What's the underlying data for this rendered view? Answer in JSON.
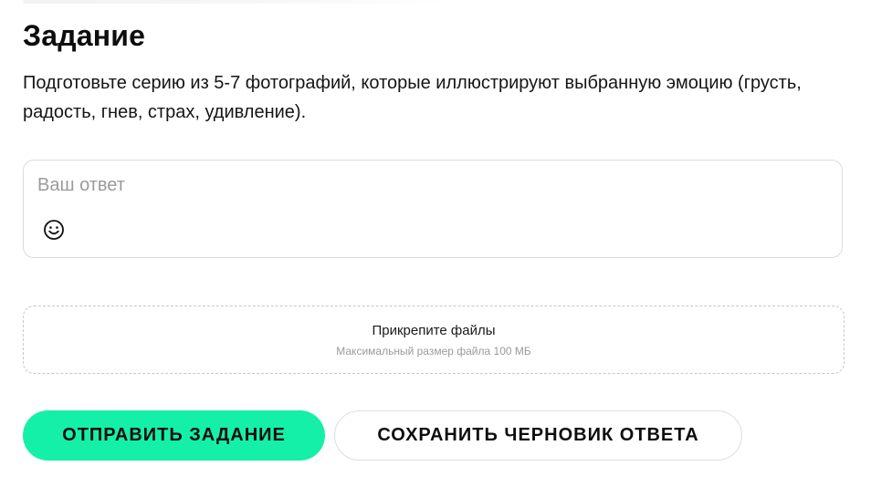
{
  "task": {
    "title": "Задание",
    "description": "Подготовьте серию из 5-7 фотографий, которые иллюстрируют выбранную эмоцию (грусть, радость, гнев, страх, удивление)."
  },
  "answer": {
    "placeholder": "Ваш ответ",
    "value": "",
    "emoji_icon": "smiley-icon"
  },
  "upload": {
    "title": "Прикрепите файлы",
    "hint": "Максимальный размер файла 100 МБ"
  },
  "actions": {
    "submit_label": "ОТПРАВИТЬ ЗАДАНИЕ",
    "draft_label": "СОХРАНИТЬ ЧЕРНОВИК ОТВЕТА"
  },
  "colors": {
    "accent": "#15f0a8",
    "border": "#dcdcdc",
    "placeholder": "#9a9a9a"
  }
}
